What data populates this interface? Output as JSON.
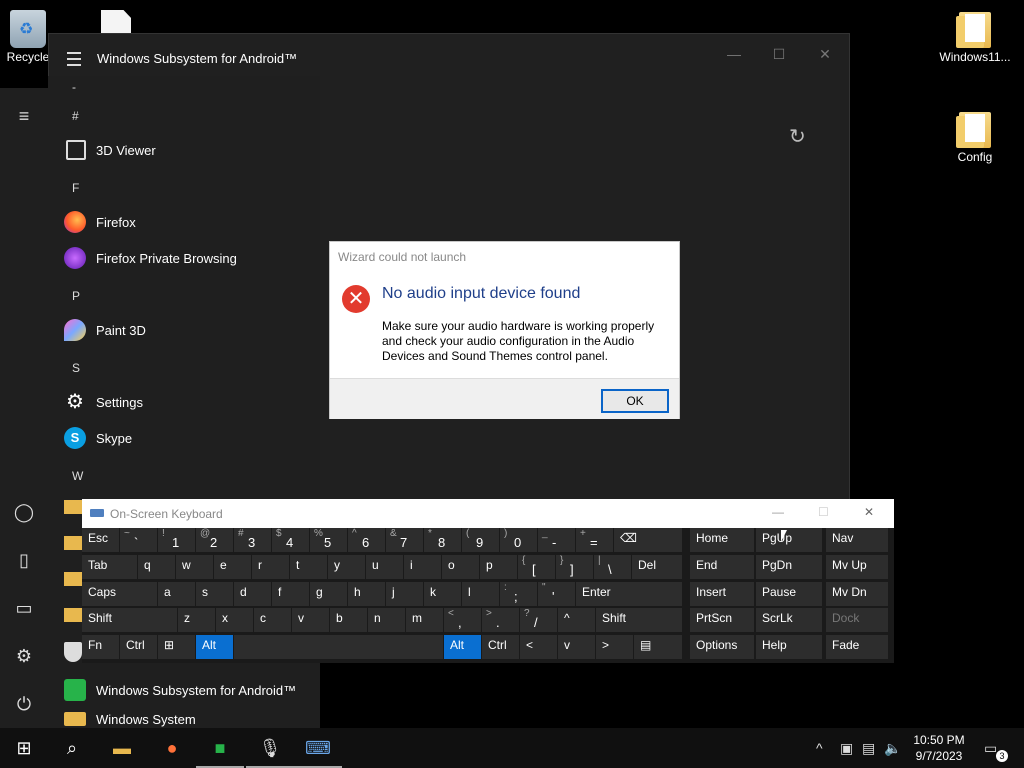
{
  "desktop": {
    "icons": [
      {
        "label": "Recycle"
      },
      {
        "label": ""
      },
      {
        "label": "Windows11..."
      },
      {
        "label": "Config"
      }
    ]
  },
  "app_window": {
    "title": "Windows Subsystem for Android™"
  },
  "start_menu": {
    "dash": "-",
    "groups": [
      "#",
      "F",
      "P",
      "S",
      "W"
    ],
    "apps": [
      {
        "label": "3D Viewer"
      },
      {
        "label": "Firefox"
      },
      {
        "label": "Firefox Private Browsing"
      },
      {
        "label": "Paint 3D"
      },
      {
        "label": "Settings"
      },
      {
        "label": "Skype"
      },
      {
        "label": "Windows Subsystem for Android™"
      },
      {
        "label": "Windows System"
      }
    ]
  },
  "dialog": {
    "title": "Wizard could not launch",
    "heading": "No audio input device found",
    "body": "Make sure your audio hardware is working properly and check your audio configuration in the Audio Devices and Sound Themes control panel.",
    "ok_label": "OK"
  },
  "osk": {
    "title": "On-Screen Keyboard",
    "row1": [
      {
        "main": "Esc"
      },
      {
        "sub": "~",
        "main": "`"
      },
      {
        "sub": "!",
        "main": "1"
      },
      {
        "sub": "@",
        "main": "2"
      },
      {
        "sub": "#",
        "main": "3"
      },
      {
        "sub": "$",
        "main": "4"
      },
      {
        "sub": "%",
        "main": "5"
      },
      {
        "sub": "^",
        "main": "6"
      },
      {
        "sub": "&",
        "main": "7"
      },
      {
        "sub": "*",
        "main": "8"
      },
      {
        "sub": "(",
        "main": "9"
      },
      {
        "sub": ")",
        "main": "0"
      },
      {
        "sub": "_",
        "main": "-"
      },
      {
        "sub": "+",
        "main": "="
      },
      {
        "main": "⌫"
      }
    ],
    "row2": [
      {
        "main": "Tab"
      },
      {
        "main": "q"
      },
      {
        "main": "w"
      },
      {
        "main": "e"
      },
      {
        "main": "r"
      },
      {
        "main": "t"
      },
      {
        "main": "y"
      },
      {
        "main": "u"
      },
      {
        "main": "i"
      },
      {
        "main": "o"
      },
      {
        "main": "p"
      },
      {
        "sub": "{",
        "main": "["
      },
      {
        "sub": "}",
        "main": "]"
      },
      {
        "sub": "|",
        "main": "\\"
      },
      {
        "main": "Del"
      }
    ],
    "row3": [
      {
        "main": "Caps"
      },
      {
        "main": "a"
      },
      {
        "main": "s"
      },
      {
        "main": "d"
      },
      {
        "main": "f"
      },
      {
        "main": "g"
      },
      {
        "main": "h"
      },
      {
        "main": "j"
      },
      {
        "main": "k"
      },
      {
        "main": "l"
      },
      {
        "sub": ":",
        "main": ";"
      },
      {
        "sub": "\"",
        "main": "'"
      },
      {
        "main": "Enter"
      }
    ],
    "row4": [
      {
        "main": "Shift"
      },
      {
        "main": "z"
      },
      {
        "main": "x"
      },
      {
        "main": "c"
      },
      {
        "main": "v"
      },
      {
        "main": "b"
      },
      {
        "main": "n"
      },
      {
        "main": "m"
      },
      {
        "sub": "<",
        "main": ","
      },
      {
        "sub": ">",
        "main": "."
      },
      {
        "sub": "?",
        "main": "/"
      },
      {
        "main": "^"
      },
      {
        "main": "Shift"
      }
    ],
    "row5": [
      {
        "main": "Fn"
      },
      {
        "main": "Ctrl"
      },
      {
        "main": "⊞"
      },
      {
        "main": "Alt"
      },
      {
        "main": ""
      },
      {
        "main": "Alt"
      },
      {
        "main": "Ctrl"
      },
      {
        "main": "<"
      },
      {
        "main": "v"
      },
      {
        "main": ">"
      },
      {
        "main": "▤"
      }
    ],
    "nav": [
      [
        "Home",
        "PgUp",
        "Nav"
      ],
      [
        "End",
        "PgDn",
        "Mv Up"
      ],
      [
        "Insert",
        "Pause",
        "Mv Dn"
      ],
      [
        "PrtScn",
        "ScrLk",
        "Dock"
      ],
      [
        "Options",
        "Help",
        "Fade"
      ]
    ]
  },
  "taskbar": {
    "clock_time": "10:50 PM",
    "clock_date": "9/7/2023",
    "notification_count": "3"
  }
}
